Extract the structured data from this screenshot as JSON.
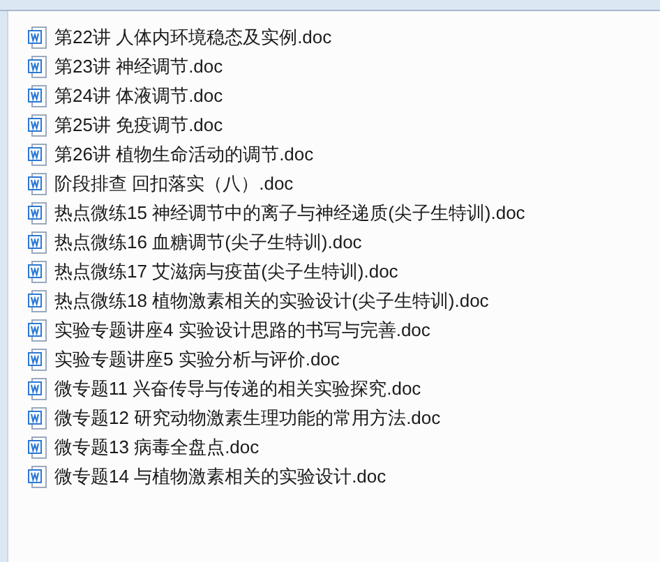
{
  "files": [
    {
      "name": "第22讲 人体内环境稳态及实例.doc"
    },
    {
      "name": "第23讲 神经调节.doc"
    },
    {
      "name": "第24讲 体液调节.doc"
    },
    {
      "name": "第25讲 免疫调节.doc"
    },
    {
      "name": "第26讲 植物生命活动的调节.doc"
    },
    {
      "name": "阶段排查 回扣落实（八）.doc"
    },
    {
      "name": "热点微练15 神经调节中的离子与神经递质(尖子生特训).doc"
    },
    {
      "name": "热点微练16 血糖调节(尖子生特训).doc"
    },
    {
      "name": "热点微练17 艾滋病与疫苗(尖子生特训).doc"
    },
    {
      "name": "热点微练18 植物激素相关的实验设计(尖子生特训).doc"
    },
    {
      "name": "实验专题讲座4 实验设计思路的书写与完善.doc"
    },
    {
      "name": "实验专题讲座5 实验分析与评价.doc"
    },
    {
      "name": "微专题11 兴奋传导与传递的相关实验探究.doc"
    },
    {
      "name": "微专题12 研究动物激素生理功能的常用方法.doc"
    },
    {
      "name": "微专题13 病毒全盘点.doc"
    },
    {
      "name": "微专题14 与植物激素相关的实验设计.doc"
    }
  ]
}
